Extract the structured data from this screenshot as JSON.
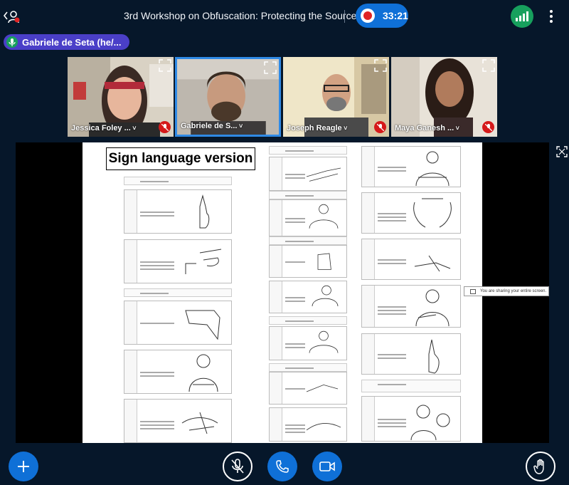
{
  "header": {
    "title": "3rd Workshop on Obfuscation: Protecting the Source",
    "recording_time": "33:21",
    "connection_color": "#17a05d"
  },
  "talking_indicator": {
    "name": "Gabriele de Seta (he/..."
  },
  "participants": [
    {
      "name": "Jessica Foley ...",
      "muted": true,
      "active": false
    },
    {
      "name": "Gabriele de S...",
      "muted": false,
      "active": true
    },
    {
      "name": "Joseph Reagle",
      "muted": true,
      "active": false
    },
    {
      "name": "Maya Ganesh ...",
      "muted": true,
      "active": false
    }
  ],
  "screenshare": {
    "slide_label": "Sign language version",
    "sharing_notice": "You are sharing your entire screen."
  },
  "controls": {
    "actions": "plus-icon",
    "mic": "mic-muted-icon",
    "phone": "phone-icon",
    "camera": "video-camera-icon",
    "raise_hand": "hand-icon"
  },
  "colors": {
    "background": "#06172a",
    "accent": "#0f70d7",
    "muted_badge": "#d5191a",
    "talking_pill": "#4a3fc8"
  }
}
